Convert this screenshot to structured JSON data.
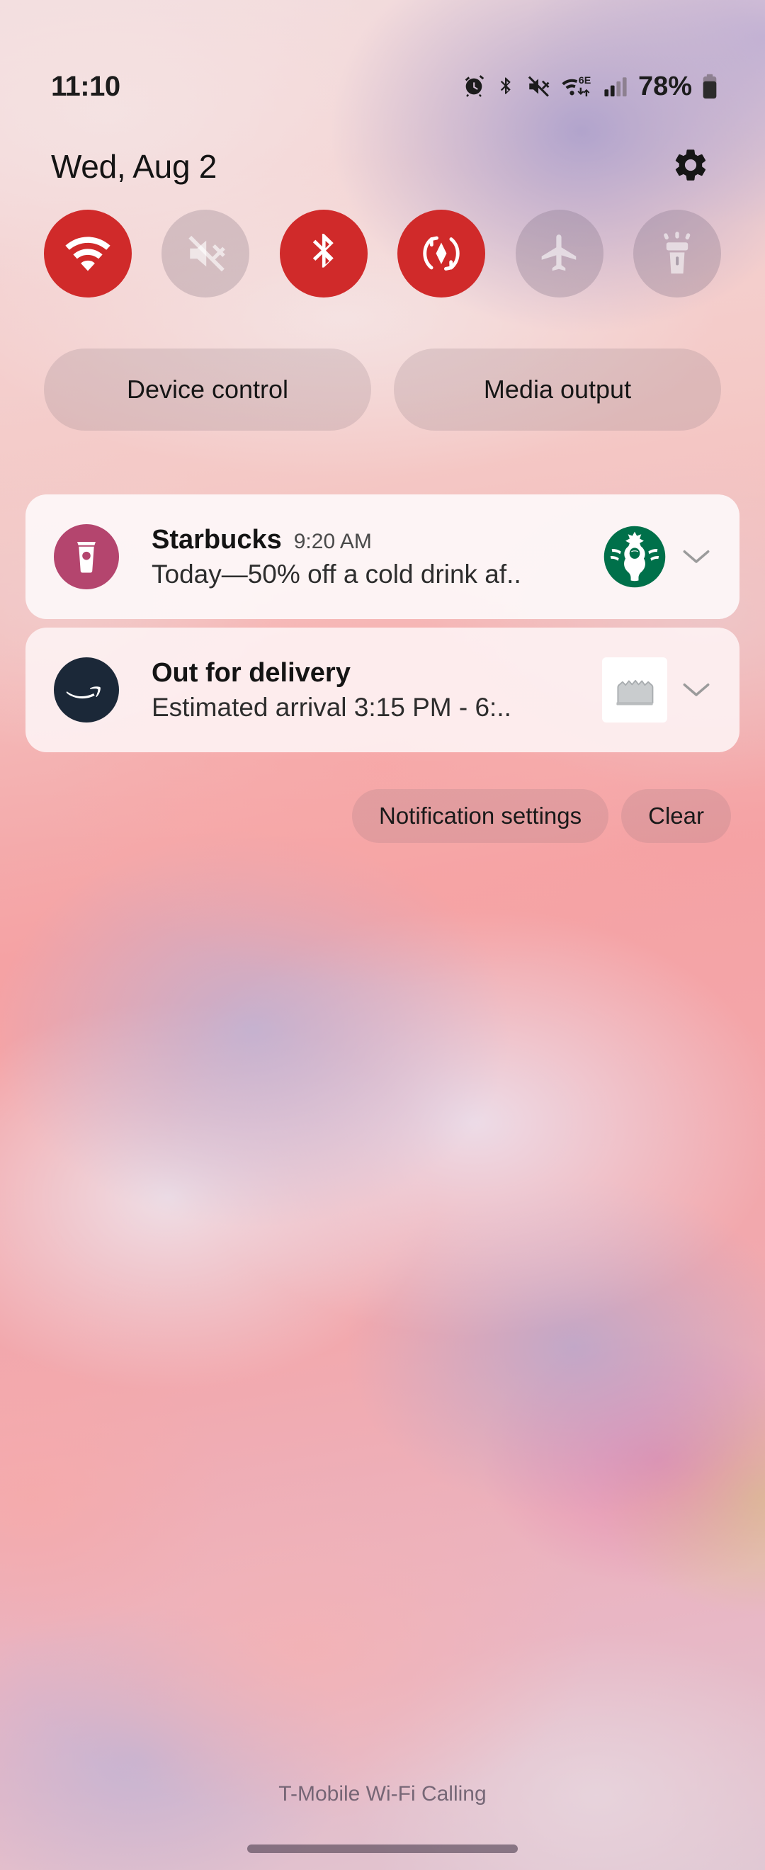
{
  "status_bar": {
    "time": "11:10",
    "battery_percent": "78%",
    "icons": [
      {
        "name": "alarm-icon",
        "label": "Alarm set"
      },
      {
        "name": "bluetooth-icon",
        "label": "Bluetooth on"
      },
      {
        "name": "mute-icon",
        "label": "Sound muted"
      },
      {
        "name": "wifi-6e-icon",
        "label": "Wi-Fi 6E"
      },
      {
        "name": "cellular-signal-icon",
        "label": "Cellular signal"
      },
      {
        "name": "battery-icon",
        "label": "Battery"
      }
    ]
  },
  "header": {
    "date": "Wed, Aug 2",
    "settings_icon": "gear-icon"
  },
  "quick_settings": {
    "accent_on_color": "#d02a2a",
    "toggles": [
      {
        "id": "wifi",
        "label": "Wi-Fi",
        "icon": "wifi-icon",
        "state": "on"
      },
      {
        "id": "sound",
        "label": "Mute",
        "icon": "mute-icon",
        "state": "off"
      },
      {
        "id": "bluetooth",
        "label": "Bluetooth",
        "icon": "bluetooth-icon",
        "state": "on"
      },
      {
        "id": "auto-rotate",
        "label": "Auto rotate",
        "icon": "auto-rotate-icon",
        "state": "on"
      },
      {
        "id": "airplane",
        "label": "Airplane mode",
        "icon": "airplane-icon",
        "state": "off"
      },
      {
        "id": "flashlight",
        "label": "Flashlight",
        "icon": "flashlight-icon",
        "state": "off"
      }
    ],
    "pills": [
      {
        "id": "device-control",
        "label": "Device control"
      },
      {
        "id": "media-output",
        "label": "Media output"
      }
    ]
  },
  "notifications": [
    {
      "id": "starbucks",
      "app_icon": "starbucks-cup-icon",
      "app_icon_color": "#b4456e",
      "title": "Starbucks",
      "time": "9:20 AM",
      "text": "Today—50% off a cold drink af..",
      "thumbnail": "starbucks-siren-logo",
      "thumbnail_color": "#00704a",
      "expand_icon": "chevron-down-icon"
    },
    {
      "id": "amazon-delivery",
      "app_icon": "amazon-smile-icon",
      "app_icon_color": "#1b2838",
      "title": "Out for delivery",
      "time": "",
      "text": "Estimated arrival 3:15 PM - 6:..",
      "thumbnail": "package-product-image",
      "thumbnail_color": "#c3c6c8",
      "expand_icon": "chevron-down-icon"
    }
  ],
  "notification_actions": [
    {
      "id": "notification-settings",
      "label": "Notification settings"
    },
    {
      "id": "clear",
      "label": "Clear"
    }
  ],
  "footer": {
    "carrier_status": "T-Mobile Wi-Fi Calling"
  }
}
